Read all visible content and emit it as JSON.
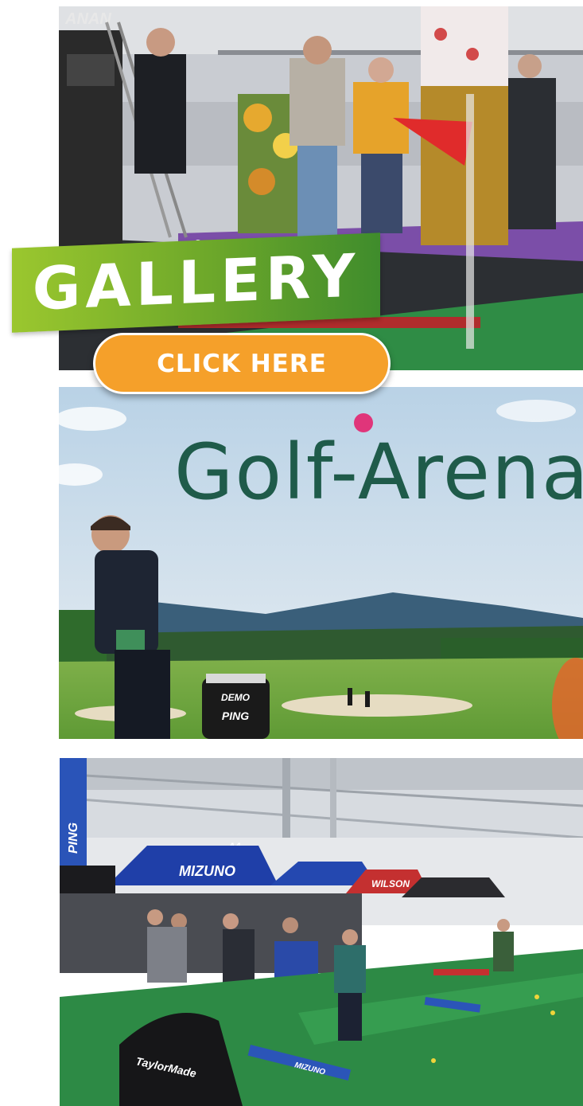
{
  "banner": {
    "gallery_label": "GALLERY",
    "cta_label": "CLICK HERE"
  },
  "photo1": {
    "bag_brand": "ANAN"
  },
  "photo2": {
    "wall_text": "Golf-Arena",
    "bag_label_1": "DEMO",
    "bag_label_2": "PING"
  },
  "photo3": {
    "hall_sign": "A4",
    "tent_brand": "MIZUNO",
    "tent_brand_2": "WILSON",
    "mat_brand": "MIZUNO",
    "net_brand": "TaylorMade",
    "pole_banner": "PING"
  },
  "colors": {
    "banner_green": "#6ca72a",
    "cta_orange": "#f5a02a",
    "arena_green": "#1f5b4a"
  }
}
